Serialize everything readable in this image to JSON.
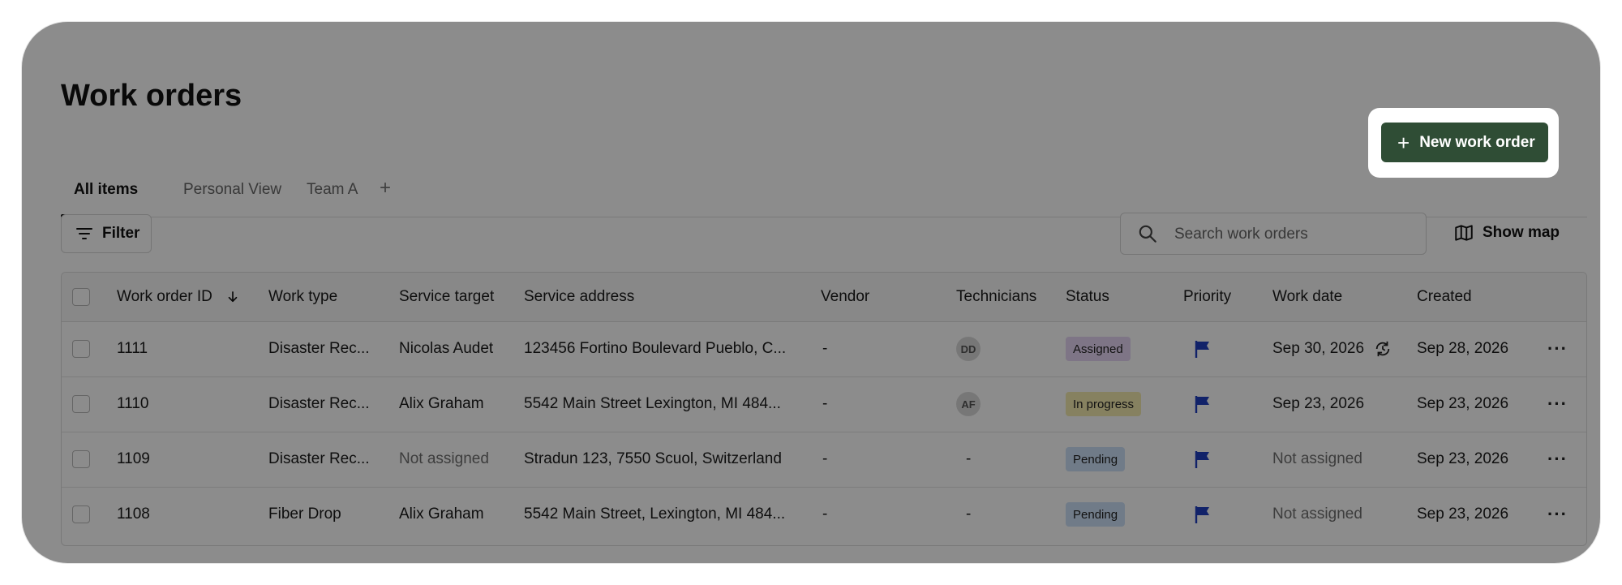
{
  "page": {
    "title": "Work orders"
  },
  "tabs": {
    "items": [
      {
        "label": "All items",
        "active": true
      },
      {
        "label": "Personal View",
        "active": false
      },
      {
        "label": "Team A",
        "active": false
      }
    ],
    "add_label": "+"
  },
  "toolbar": {
    "new_button_label": "New work order",
    "filter_label": "Filter",
    "search_placeholder": "Search work orders",
    "show_map_label": "Show map"
  },
  "table": {
    "columns": {
      "id": "Work order ID",
      "work_type": "Work type",
      "service_target": "Service target",
      "service_address": "Service address",
      "vendor": "Vendor",
      "technicians": "Technicians",
      "status": "Status",
      "priority": "Priority",
      "work_date": "Work date",
      "created": "Created"
    },
    "rows": [
      {
        "id": "1111",
        "work_type": "Disaster Rec...",
        "service_target": "Nicolas Audet",
        "service_address": "123456 Fortino Boulevard Pueblo, C...",
        "vendor": "-",
        "technician": "DD",
        "status": "Assigned",
        "work_date": "Sep 30, 2026",
        "created": "Sep 28, 2026"
      },
      {
        "id": "1110",
        "work_type": "Disaster Rec...",
        "service_target": "Alix Graham",
        "service_address": "5542 Main Street Lexington, MI 484...",
        "vendor": "-",
        "technician": "AF",
        "status": "In progress",
        "work_date": "Sep 23, 2026",
        "created": "Sep 23, 2026"
      },
      {
        "id": "1109",
        "work_type": "Disaster Rec...",
        "service_target": "Not assigned",
        "service_address": "Stradun 123, 7550 Scuol, Switzerland",
        "vendor": "-",
        "technician": "-",
        "status": "Pending",
        "work_date": "Not assigned",
        "created": "Sep 23, 2026"
      },
      {
        "id": "1108",
        "work_type": "Fiber Drop",
        "service_target": "Alix Graham",
        "service_address": "5542 Main Street, Lexington, MI 484...",
        "vendor": "-",
        "technician": "-",
        "status": "Pending",
        "work_date": "Not assigned",
        "created": "Sep 23, 2026"
      }
    ]
  },
  "colors": {
    "primary_button": "#2f4d35",
    "status_assigned": "#e6d6f5",
    "status_in_progress": "#f5ebb0",
    "status_pending": "#cde0f7",
    "priority_flag": "#1f3fbf"
  },
  "icons": {
    "filter": "filter-icon",
    "search": "search-icon",
    "map": "map-icon",
    "flag": "flag-icon",
    "recurring": "recurring-icon",
    "more": "more-icon",
    "sort": "arrow-down-icon"
  }
}
